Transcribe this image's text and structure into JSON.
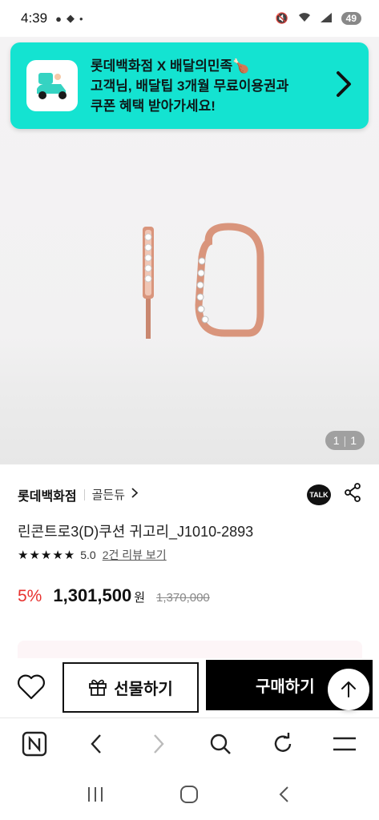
{
  "status_bar": {
    "time": "4:39",
    "battery": "49"
  },
  "banner": {
    "line1": "롯데백화점 X 배달의민족🍗",
    "line2": "고객님, 배달팁 3개월 무료이용권과",
    "line3": "쿠폰 혜택 받아가세요!"
  },
  "image": {
    "current": "1",
    "total": "1"
  },
  "product": {
    "seller": "롯데백화점",
    "brand": "골든듀",
    "talk_label": "TALK",
    "title": "린콘트로3(D)쿠션 귀고리_J1010-2893",
    "stars": "★★★★★",
    "rating": "5.0",
    "reviews": "2건 리뷰 보기",
    "discount": "5%",
    "price": "1,301,500",
    "won": "원",
    "original_price": "1,370,000"
  },
  "actions": {
    "gift_label": "선물하기",
    "buy_label": "구매하기"
  },
  "colors": {
    "banner_bg": "#14e3d1",
    "discount": "#e8322f",
    "buy_bg": "#000000"
  }
}
